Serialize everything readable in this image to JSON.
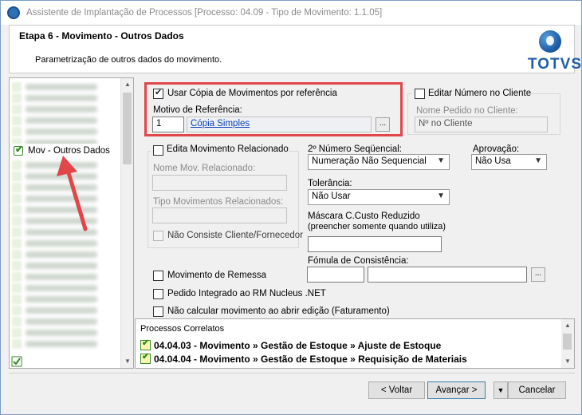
{
  "window": {
    "title": "Assistente de Implantação de Processos [Processo: 04.09 - Tipo de Movimento: 1.1.05]"
  },
  "header": {
    "step_title": "Etapa 6 - Movimento - Outros Dados",
    "subtitle": "Parametrização de outros dados do movimento.",
    "logo_text": "TOTVS"
  },
  "tree": {
    "selected_label": "Mov - Outros Dados"
  },
  "copy_group": {
    "use_copy_label": "Usar Cópia de Movimentos por referência",
    "use_copy_checked": true,
    "reason_label": "Motivo de Referência:",
    "reason_code": "1",
    "reason_desc": "Cópia Simples",
    "lookup_label": "..."
  },
  "client_group": {
    "edit_number_label": "Editar Número no Cliente",
    "order_name_label": "Nome Pedido no Cliente:",
    "order_name_value": "Nº no Cliente"
  },
  "related_group": {
    "edit_related_label": "Edita Movimento Relacionado",
    "related_name_label": "Nome Mov. Relacionado:",
    "related_types_label": "Tipo Movimentos Relacionados:",
    "no_check_label": "Não Consiste Cliente/Fornecedor"
  },
  "second_seq": {
    "label": "2º Número Seqüencial:",
    "value": "Numeração Não Sequencial"
  },
  "approval": {
    "label": "Aprovação:",
    "value": "Não Usa"
  },
  "tolerance": {
    "label": "Tolerância:",
    "value": "Não Usar"
  },
  "cost_mask": {
    "label_line1": "Máscara C.Custo Reduzido",
    "label_line2": "(preencher somente quando utiliza)"
  },
  "formula": {
    "label": "Fómula de Consistência:",
    "lookup_label": "..."
  },
  "options": {
    "remessa_label": "Movimento de Remessa",
    "nucleus_label": "Pedido Integrado ao RM Nucleus .NET",
    "no_calc_label": "Não calcular movimento ao abrir edição (Faturamento)"
  },
  "processes": {
    "title": "Processos Correlatos",
    "rows": [
      "04.04.03 - Movimento » Gestão de Estoque » Ajuste de Estoque",
      "04.04.04 - Movimento » Gestão de Estoque » Requisição de Materiais"
    ]
  },
  "buttons": {
    "back": "< Voltar",
    "next": "Avançar >",
    "cancel": "Cancelar"
  },
  "colors": {
    "highlight_box": "#e0464a",
    "arrow": "#e0464a",
    "brand": "#1f5fa8"
  }
}
